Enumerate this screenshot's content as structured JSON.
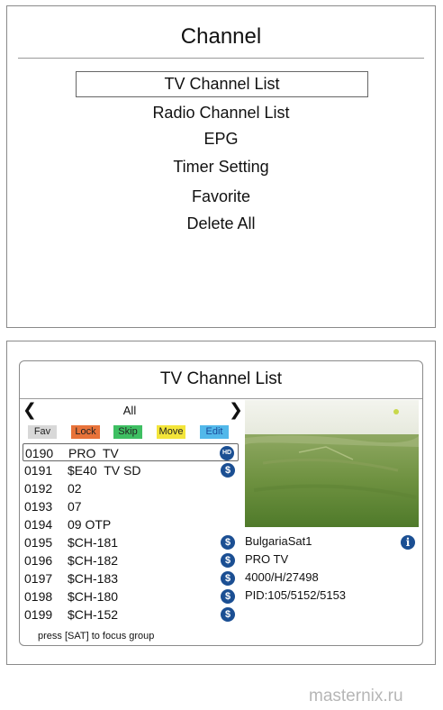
{
  "channel_menu": {
    "title": "Channel",
    "items": [
      "TV Channel List",
      "Radio Channel List",
      "EPG",
      "Timer Setting",
      "Favorite",
      "Delete All"
    ]
  },
  "tv_channel_list": {
    "title": "TV Channel List",
    "group": "All",
    "arrow_left": "❮",
    "arrow_right": "❯",
    "tags": {
      "fav": "Fav",
      "lock": "Lock",
      "skip": "Skip",
      "move": "Move",
      "edit": "Edit"
    },
    "channels": [
      {
        "number": "0190",
        "name": "PRO  TV",
        "badge": "HD"
      },
      {
        "number": "0191",
        "name": "$E40  TV SD",
        "badge": "$"
      },
      {
        "number": "0192",
        "name": "02",
        "badge": ""
      },
      {
        "number": "0193",
        "name": "07",
        "badge": ""
      },
      {
        "number": "0194",
        "name": "09 OTP",
        "badge": ""
      },
      {
        "number": "0195",
        "name": "$CH-181",
        "badge": "$"
      },
      {
        "number": "0196",
        "name": "$CH-182",
        "badge": "$"
      },
      {
        "number": "0197",
        "name": "$CH-183",
        "badge": "$"
      },
      {
        "number": "0198",
        "name": "$CH-180",
        "badge": "$"
      },
      {
        "number": "0199",
        "name": "$CH-152",
        "badge": "$"
      }
    ],
    "hint": "press [SAT] to focus group",
    "info": {
      "satellite": "BulgariaSat1",
      "channel_name": "PRO TV",
      "transponder": "4000/H/27498",
      "pid": "PID:105/5152/5153",
      "info_icon": "i"
    }
  },
  "watermark": "masternix.ru",
  "colors": {
    "lock": "#e8733a",
    "skip": "#3ebf62",
    "move": "#f3e53a",
    "edit": "#52b8ea",
    "badge": "#1b4f93"
  }
}
